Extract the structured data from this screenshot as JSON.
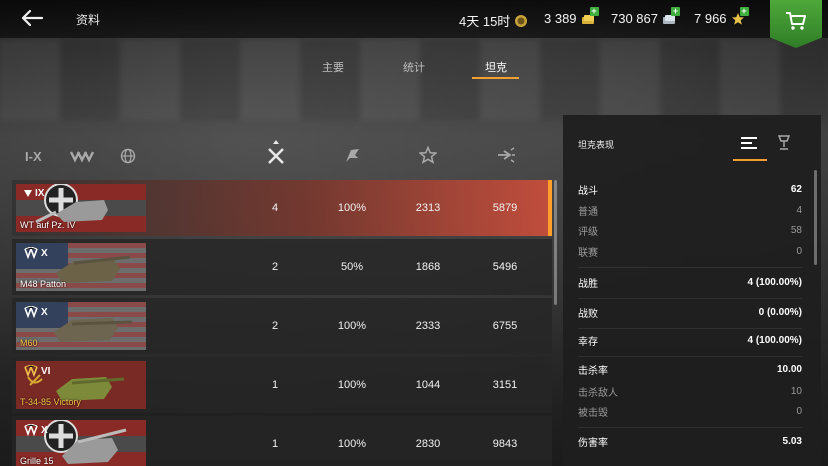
{
  "header": {
    "title": "资料",
    "timer": "4天 15时",
    "gold": "3 389",
    "silver": "730 867",
    "free_xp": "7 966"
  },
  "tabs": [
    {
      "label": "主要"
    },
    {
      "label": "统计"
    },
    {
      "label": "坦克"
    }
  ],
  "filters": {
    "tier_label": "I-X"
  },
  "colors": {
    "accent": "#f0a030",
    "selected_row": "#c84e3c",
    "shop_green": "#3fae3f",
    "gold_name": "#f2c34a"
  },
  "tanks": [
    {
      "tier": "IX",
      "name": "WT auf Pz. IV",
      "battles": "4",
      "winrate": "100%",
      "avg_xp": "2313",
      "avg_damage": "5879",
      "flag": "germany",
      "selected": true,
      "premium": false
    },
    {
      "tier": "X",
      "name": "M48 Patton",
      "battles": "2",
      "winrate": "50%",
      "avg_xp": "1868",
      "avg_damage": "5496",
      "flag": "usa",
      "selected": false,
      "premium": false
    },
    {
      "tier": "X",
      "name": "M60",
      "battles": "2",
      "winrate": "100%",
      "avg_xp": "2333",
      "avg_damage": "6755",
      "flag": "usa",
      "selected": false,
      "premium": true
    },
    {
      "tier": "VI",
      "name": "T-34-85 Victory",
      "battles": "1",
      "winrate": "100%",
      "avg_xp": "1044",
      "avg_damage": "3151",
      "flag": "ussr",
      "selected": false,
      "premium": true
    },
    {
      "tier": "X",
      "name": "Grille 15",
      "battles": "1",
      "winrate": "100%",
      "avg_xp": "2830",
      "avg_damage": "9843",
      "flag": "germany",
      "selected": false,
      "premium": false
    }
  ],
  "panel": {
    "title": "坦克表现",
    "stats": [
      {
        "label": "战斗",
        "value": "62",
        "type": "main"
      },
      {
        "label": "普通",
        "value": "4",
        "type": "sub"
      },
      {
        "label": "评级",
        "value": "58",
        "type": "sub"
      },
      {
        "label": "联赛",
        "value": "0",
        "type": "sub"
      },
      {
        "label": "战胜",
        "value": "4 (100.00%)",
        "type": "main"
      },
      {
        "label": "战败",
        "value": "0 (0.00%)",
        "type": "main"
      },
      {
        "label": "幸存",
        "value": "4 (100.00%)",
        "type": "main"
      },
      {
        "label": "击杀率",
        "value": "10.00",
        "type": "main"
      },
      {
        "label": "击杀敌人",
        "value": "10",
        "type": "sub"
      },
      {
        "label": "被击毁",
        "value": "0",
        "type": "sub"
      },
      {
        "label": "伤害率",
        "value": "5.03",
        "type": "main"
      }
    ]
  }
}
